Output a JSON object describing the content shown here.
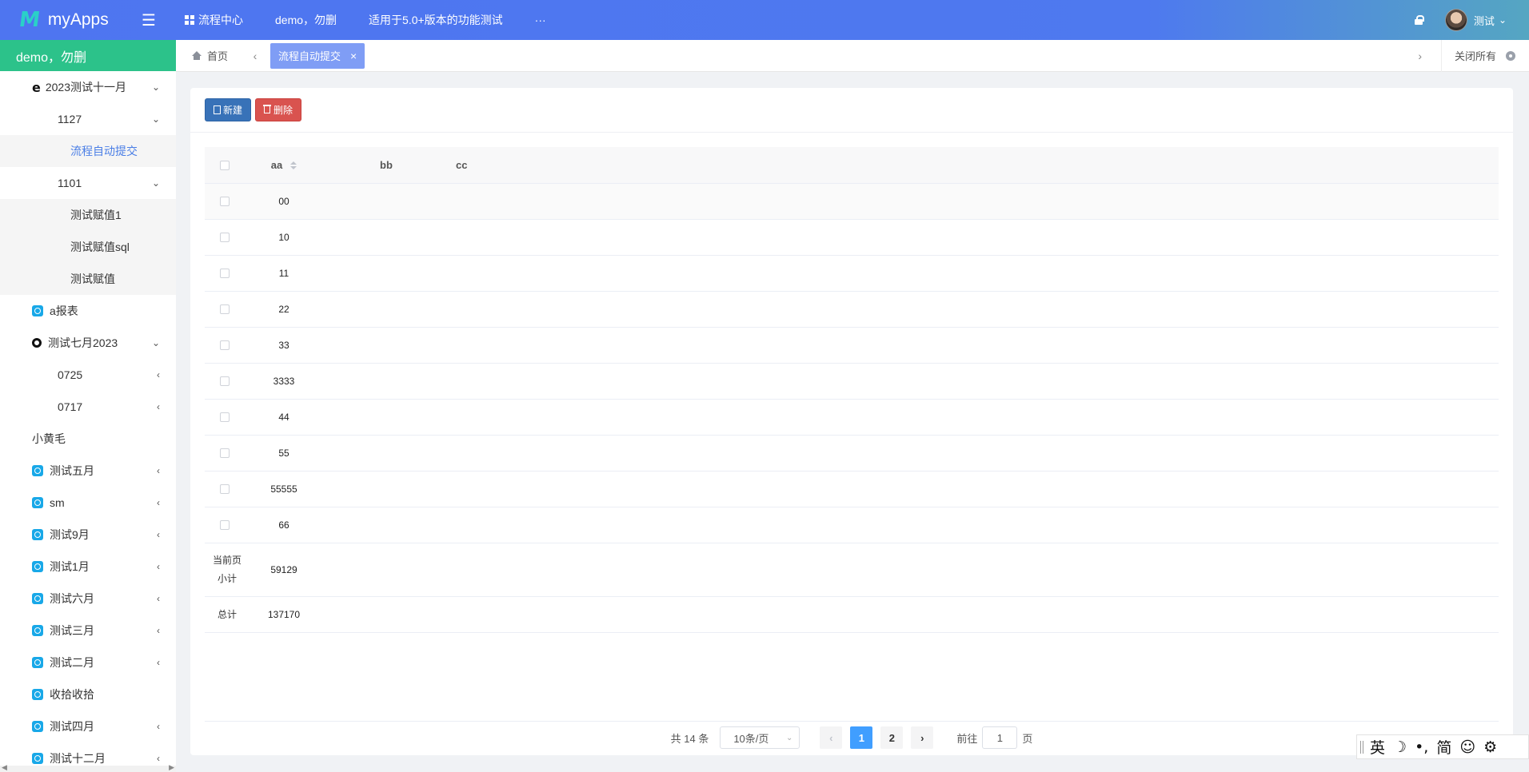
{
  "app": {
    "logo_mark": "M",
    "name": "myApps",
    "menu_toggle_icon": "☰"
  },
  "topnav": {
    "items": [
      {
        "label": "流程中心",
        "icon": "grid-icon"
      },
      {
        "label": "demo，勿删"
      },
      {
        "label": "适用于5.0+版本的功能测试"
      },
      {
        "label": "···",
        "icon": "more-icon"
      }
    ]
  },
  "user": {
    "name": "测试",
    "chevron": "⌄"
  },
  "sidebar": {
    "title": "demo，勿删",
    "items": [
      {
        "label": "2023测试十一月",
        "level": 1,
        "icon": "e-icon",
        "arrow": "⌄"
      },
      {
        "label": "1127",
        "level": 2,
        "arrow": "⌄"
      },
      {
        "label": "流程自动提交",
        "level": 3,
        "active": true
      },
      {
        "label": "1101",
        "level": 2,
        "arrow": "⌄"
      },
      {
        "label": "测试赋值1",
        "level": 3
      },
      {
        "label": "测试赋值sql",
        "level": 3
      },
      {
        "label": "测试赋值",
        "level": 3
      },
      {
        "label": "a报表",
        "level": 1,
        "icon": "app-icon"
      },
      {
        "label": "测试七月2023",
        "level": 1,
        "icon": "ring-icon",
        "arrow": "⌄"
      },
      {
        "label": "0725",
        "level": 2,
        "arrow": "‹"
      },
      {
        "label": "0717",
        "level": 2,
        "arrow": "‹"
      },
      {
        "label": "小黄毛",
        "level": 1
      },
      {
        "label": "测试五月",
        "level": 1,
        "icon": "app-icon",
        "arrow": "‹"
      },
      {
        "label": "sm",
        "level": 1,
        "icon": "app-icon",
        "arrow": "‹"
      },
      {
        "label": "测试9月",
        "level": 1,
        "icon": "app-icon",
        "arrow": "‹"
      },
      {
        "label": "测试1月",
        "level": 1,
        "icon": "app-icon",
        "arrow": "‹"
      },
      {
        "label": "测试六月",
        "level": 1,
        "icon": "app-icon",
        "arrow": "‹"
      },
      {
        "label": "测试三月",
        "level": 1,
        "icon": "app-icon",
        "arrow": "‹"
      },
      {
        "label": "测试二月",
        "level": 1,
        "icon": "app-icon",
        "arrow": "‹"
      },
      {
        "label": "收拾收拾",
        "level": 1,
        "icon": "app-icon"
      },
      {
        "label": "测试四月",
        "level": 1,
        "icon": "app-icon",
        "arrow": "‹"
      },
      {
        "label": "测试十二月",
        "level": 1,
        "icon": "app-icon",
        "arrow": "‹"
      }
    ]
  },
  "tabs": {
    "home_label": "首页",
    "left_arrow": "‹",
    "right_arrow": "›",
    "active_label": "流程自动提交",
    "close_symbol": "×",
    "close_all_label": "关闭所有"
  },
  "toolbar": {
    "new_label": "新建",
    "delete_label": "删除"
  },
  "table": {
    "columns": [
      "aa",
      "bb",
      "cc"
    ],
    "rows": [
      {
        "aa": "00",
        "bb": "",
        "cc": ""
      },
      {
        "aa": "10",
        "bb": "",
        "cc": ""
      },
      {
        "aa": "11",
        "bb": "",
        "cc": ""
      },
      {
        "aa": "22",
        "bb": "",
        "cc": ""
      },
      {
        "aa": "33",
        "bb": "",
        "cc": ""
      },
      {
        "aa": "3333",
        "bb": "",
        "cc": ""
      },
      {
        "aa": "44",
        "bb": "",
        "cc": ""
      },
      {
        "aa": "55",
        "bb": "",
        "cc": ""
      },
      {
        "aa": "55555",
        "bb": "",
        "cc": ""
      },
      {
        "aa": "66",
        "bb": "",
        "cc": ""
      }
    ],
    "subtotal_label_1": "当前页",
    "subtotal_label_2": "小计",
    "subtotal_value": "59129",
    "total_label": "总计",
    "total_value": "137170"
  },
  "pagination": {
    "total_text": "共 14 条",
    "page_size": "10条/页",
    "pages": [
      "1",
      "2"
    ],
    "current_page": "1",
    "prev": "‹",
    "next": "›",
    "goto_label": "前往",
    "goto_value": "1",
    "page_suffix": "页"
  },
  "ime": {
    "lang": "英",
    "moon": "☽",
    "punct": "•,",
    "script": "简",
    "emoji": "☺",
    "settings": "⚙"
  },
  "colors": {
    "topbar_accent": "#4e75f0",
    "sidebar_header": "#2cc28a",
    "active_tab": "#7f9df5",
    "btn_new": "#3872b8",
    "btn_delete": "#d9534f",
    "page_active": "#409eff"
  }
}
